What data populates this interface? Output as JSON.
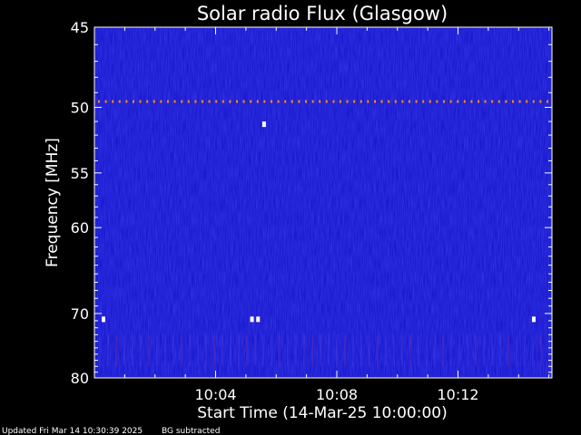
{
  "chart_data": {
    "type": "heatmap",
    "title": "Solar radio Flux (Glasgow)",
    "xlabel": "Start Time (14-Mar-25 10:00:00)",
    "ylabel": "Frequency [MHz]",
    "x_unit": "minutes after 10:00:00",
    "xlim": [
      0,
      15.1
    ],
    "ylim": [
      45,
      80
    ],
    "y_ticks": [
      45,
      50,
      55,
      60,
      70,
      80
    ],
    "y_tick_labels": [
      "45",
      "50",
      "55",
      "60",
      "70",
      "80"
    ],
    "x_ticks": [
      4,
      8,
      12
    ],
    "x_tick_labels": [
      "10:04",
      "10:08",
      "10:12"
    ],
    "background_color": "#1a1ad0",
    "features": {
      "persistent_line_mhz": 49.6,
      "persistent_line_color": "#ff8c00",
      "white_spots": [
        {
          "time_min": 5.6,
          "freq_mhz": 51.2
        },
        {
          "time_min": 0.3,
          "freq_mhz": 70.8
        },
        {
          "time_min": 5.2,
          "freq_mhz": 70.8
        },
        {
          "time_min": 5.4,
          "freq_mhz": 70.8
        },
        {
          "time_min": 14.5,
          "freq_mhz": 70.8
        }
      ],
      "interference_band_mhz": [
        73,
        78
      ]
    }
  },
  "footer": {
    "updated": "Updated Fri Mar 14 10:30:39 2025",
    "note": "BG subtracted"
  }
}
